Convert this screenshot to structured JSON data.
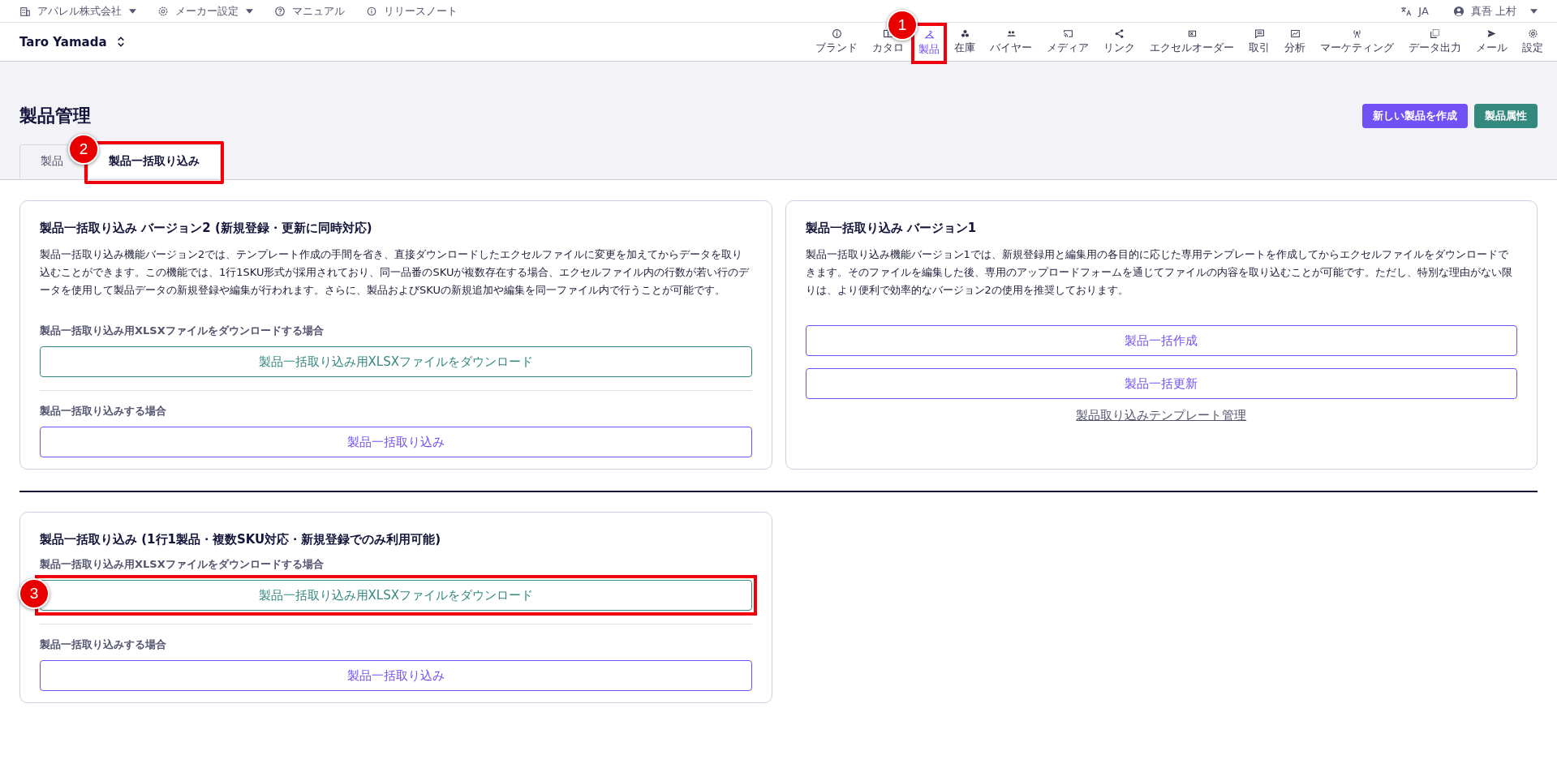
{
  "top_bar": {
    "menus": [
      {
        "label": "アパレル株式会社",
        "dropdown": true
      },
      {
        "label": "メーカー設定",
        "dropdown": true
      },
      {
        "label": "マニュアル",
        "dropdown": false
      },
      {
        "label": "リリースノート",
        "dropdown": false
      }
    ],
    "language": "JA",
    "user": {
      "name": "真吾 上村",
      "dropdown": true
    }
  },
  "account": {
    "name": "Taro Yamada"
  },
  "nav": [
    {
      "label": "ブランド",
      "selected": false
    },
    {
      "label": "カタロ",
      "selected": false
    },
    {
      "label": "製品",
      "selected": true,
      "callout": "1"
    },
    {
      "label": "在庫",
      "selected": false
    },
    {
      "label": "バイヤー",
      "selected": false
    },
    {
      "label": "メディア",
      "selected": false
    },
    {
      "label": "リンク",
      "selected": false
    },
    {
      "label": "エクセルオーダー",
      "selected": false
    },
    {
      "label": "取引",
      "selected": false
    },
    {
      "label": "分析",
      "selected": false
    },
    {
      "label": "マーケティング",
      "selected": false
    },
    {
      "label": "データ出力",
      "selected": false
    },
    {
      "label": "メール",
      "selected": false
    },
    {
      "label": "設定",
      "selected": false
    }
  ],
  "page": {
    "title": "製品管理",
    "actions": [
      {
        "label": "新しい製品を作成",
        "kind": "primary"
      },
      {
        "label": "製品属性",
        "kind": "secondary"
      }
    ]
  },
  "tabs": [
    {
      "label": "製品",
      "selected": false
    },
    {
      "label": "製品一括取り込み",
      "selected": true,
      "callout": "2"
    }
  ],
  "cards": [
    {
      "title": "製品一括取り込み バージョン2 (新規登録・更新に同時対応)",
      "description": "製品一括取り込み機能バージョン2では、テンプレート作成の手間を省き、直接ダウンロードしたエクセルファイルに変更を加えてからデータを取り込むことができます。この機能では、1行1SKU形式が採用されており、同一品番のSKUが複数存在する場合、エクセルファイル内の行数が若い行のデータを使用して製品データの新規登録や編集が行われます。さらに、製品およびSKUの新規追加や編集を同一ファイル内で行うことが可能です。",
      "sections": [
        {
          "label": "製品一括取り込み用XLSXファイルをダウンロードする場合",
          "button": {
            "label": "製品一括取り込み用XLSXファイルをダウンロード",
            "kind": "download"
          }
        },
        {
          "label": "製品一括取り込みする場合",
          "button": {
            "label": "製品一括取り込み",
            "kind": "action"
          }
        }
      ]
    },
    {
      "title": "製品一括取り込み バージョン1",
      "description": "製品一括取り込み機能バージョン1では、新規登録用と編集用の各目的に応じた専用テンプレートを作成してからエクセルファイルをダウンロードできます。そのファイルを編集した後、専用のアップロードフォームを通じてファイルの内容を取り込むことが可能です。ただし、特別な理由がない限りは、より便利で効率的なバージョン2の使用を推奨しております。",
      "buttons": [
        {
          "label": "製品一括作成",
          "kind": "action"
        },
        {
          "label": "製品一括更新",
          "kind": "action"
        }
      ],
      "link": "製品取り込みテンプレート管理"
    }
  ],
  "legacy_card": {
    "title": "製品一括取り込み (1行1製品・複数SKU対応・新規登録でのみ利用可能)",
    "sections": [
      {
        "label": "製品一括取り込み用XLSXファイルをダウンロードする場合",
        "button": {
          "label": "製品一括取り込み用XLSXファイルをダウンロード",
          "kind": "download",
          "callout": "3"
        }
      },
      {
        "label": "製品一括取り込みする場合",
        "button": {
          "label": "製品一括取り込み",
          "kind": "action"
        }
      }
    ]
  }
}
